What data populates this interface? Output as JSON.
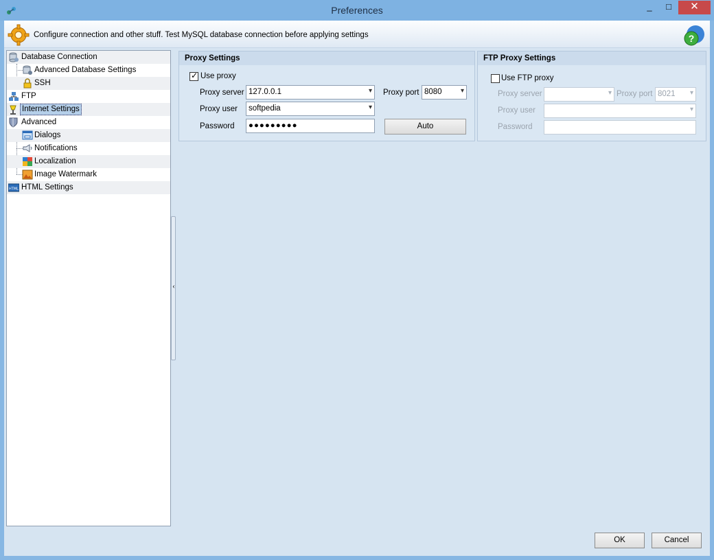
{
  "window": {
    "title": "Preferences",
    "controls": {
      "minimize": "_",
      "maximize": "□",
      "close": "✕"
    }
  },
  "header": {
    "text": "Configure connection and other stuff. Test MySQL database connection before applying settings"
  },
  "tree": {
    "items": [
      {
        "label": "Database Connection",
        "icon": "database-icon"
      },
      {
        "label": "Advanced Database Settings",
        "icon": "database-settings-icon"
      },
      {
        "label": "SSH",
        "icon": "lock-icon"
      },
      {
        "label": "FTP",
        "icon": "network-icon"
      },
      {
        "label": "Internet Settings",
        "icon": "internet-icon",
        "selected": true
      },
      {
        "label": "Advanced",
        "icon": "shield-icon"
      },
      {
        "label": "Dialogs",
        "icon": "dialog-icon"
      },
      {
        "label": "Notifications",
        "icon": "notification-icon"
      },
      {
        "label": "Localization",
        "icon": "localization-icon"
      },
      {
        "label": "Image Watermark",
        "icon": "image-icon"
      },
      {
        "label": "HTML Settings",
        "icon": "html-icon"
      }
    ]
  },
  "proxy": {
    "title": "Proxy Settings",
    "use_proxy_label": "Use proxy",
    "use_proxy_checked": true,
    "server_label": "Proxy server",
    "server_value": "127.0.0.1",
    "port_label": "Proxy port",
    "port_value": "8080",
    "user_label": "Proxy user",
    "user_value": "softpedia",
    "password_label": "Password",
    "password_value": "●●●●●●●●●",
    "auto_button": "Auto"
  },
  "ftp_proxy": {
    "title": "FTP Proxy Settings",
    "use_label": "Use FTP proxy",
    "use_checked": false,
    "server_label": "Proxy server",
    "server_value": "",
    "port_label": "Proxy port",
    "port_value": "8021",
    "user_label": "Proxy user",
    "user_value": "",
    "password_label": "Password",
    "password_value": ""
  },
  "footer": {
    "ok_label": "OK",
    "cancel_label": "Cancel"
  }
}
